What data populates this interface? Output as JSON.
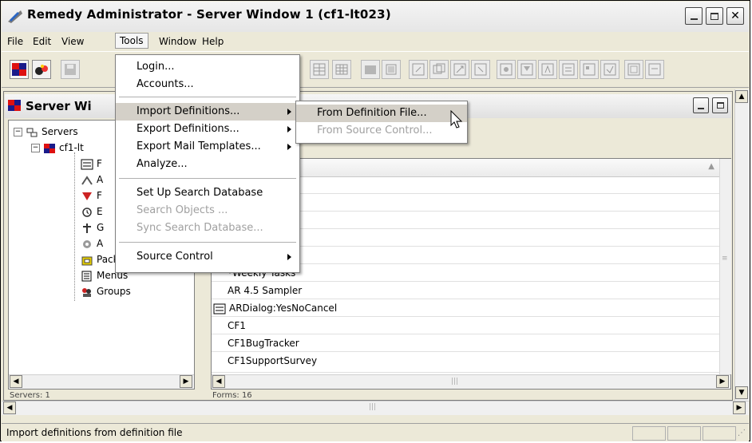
{
  "window": {
    "title": "Remedy Administrator - Server Window 1 (cf1-lt023)"
  },
  "menubar": [
    "File",
    "Edit",
    "View",
    "Tools",
    "Window",
    "Help"
  ],
  "inner_window": {
    "title": "Server Wi"
  },
  "tree": {
    "root": "Servers",
    "server": "cf1-lt",
    "items": [
      {
        "label": "F",
        "icon": "forms-icon"
      },
      {
        "label": "A",
        "icon": "active-links-icon"
      },
      {
        "label": "F",
        "icon": "filters-icon"
      },
      {
        "label": "E",
        "icon": "escalations-icon"
      },
      {
        "label": "G",
        "icon": "guides-icon"
      },
      {
        "label": "A",
        "icon": "applications-icon"
      },
      {
        "label": "Packing Lists",
        "icon": "packing-list-icon"
      },
      {
        "label": "Menus",
        "icon": "menus-icon"
      },
      {
        "label": "Groups",
        "icon": "groups-icon"
      }
    ],
    "status": "Servers: 1"
  },
  "forms_list": {
    "rows": [
      "",
      "",
      "ation",
      "",
      "",
      "*Weekly Tasks",
      "AR 4.5 Sampler",
      "ARDialog:YesNoCancel",
      "CF1",
      "CF1BugTracker",
      "CF1SupportSurvey"
    ],
    "status": "Forms: 16"
  },
  "tools_menu": {
    "items": [
      {
        "label": "Login...",
        "state": "normal"
      },
      {
        "label": "Accounts...",
        "state": "normal"
      },
      {
        "label": "Import Definitions...",
        "state": "highlighted",
        "submenu": true
      },
      {
        "label": "Export Definitions...",
        "state": "normal",
        "submenu": true
      },
      {
        "label": "Export Mail Templates...",
        "state": "normal",
        "submenu": true
      },
      {
        "label": "Analyze...",
        "state": "normal"
      },
      {
        "label": "Set Up Search Database",
        "state": "normal"
      },
      {
        "label": "Search Objects ...",
        "state": "disabled"
      },
      {
        "label": "Sync Search Database...",
        "state": "disabled"
      },
      {
        "label": "Source Control",
        "state": "normal",
        "submenu": true
      }
    ]
  },
  "import_submenu": {
    "items": [
      {
        "label": "From Definition File...",
        "state": "highlighted"
      },
      {
        "label": "From Source Control...",
        "state": "disabled"
      }
    ]
  },
  "statusbar": {
    "text": "Import definitions from definition file"
  },
  "colors": {
    "menu_highlight": "#d4d0c8",
    "disabled_text": "#a0a0a0",
    "chrome": "#ece9d8"
  }
}
